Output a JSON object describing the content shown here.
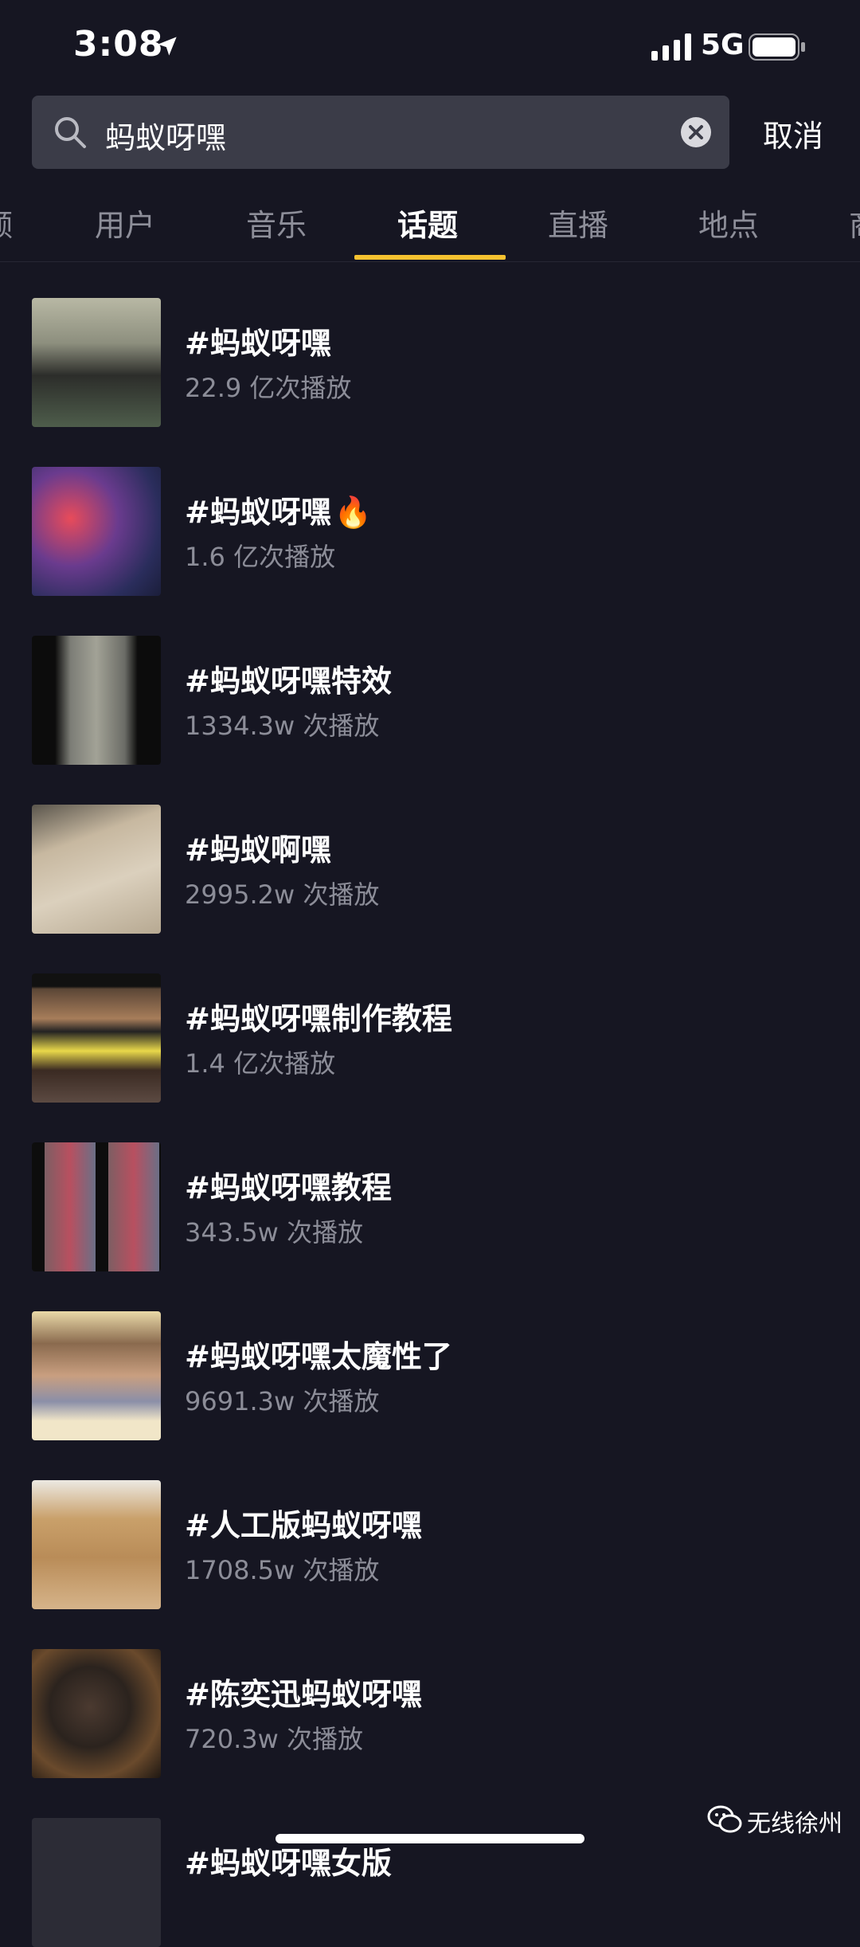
{
  "status_bar": {
    "time": "3:08",
    "network": "5G"
  },
  "search": {
    "query": "蚂蚁呀嘿",
    "cancel_label": "取消"
  },
  "tabs": [
    {
      "label": "频"
    },
    {
      "label": "用户"
    },
    {
      "label": "音乐"
    },
    {
      "label": "话题",
      "active": true
    },
    {
      "label": "直播"
    },
    {
      "label": "地点"
    },
    {
      "label": "商"
    }
  ],
  "results": [
    {
      "title": "#蚂蚁呀嘿",
      "plays": "22.9 亿次播放"
    },
    {
      "title": "#蚂蚁呀嘿",
      "badge": "🔥",
      "plays": "1.6 亿次播放"
    },
    {
      "title": "#蚂蚁呀嘿特效",
      "plays": "1334.3w 次播放"
    },
    {
      "title": "#蚂蚁啊嘿",
      "plays": "2995.2w 次播放"
    },
    {
      "title": "#蚂蚁呀嘿制作教程",
      "plays": "1.4 亿次播放"
    },
    {
      "title": "#蚂蚁呀嘿教程",
      "plays": "343.5w 次播放"
    },
    {
      "title": "#蚂蚁呀嘿太魔性了",
      "plays": "9691.3w 次播放"
    },
    {
      "title": "#人工版蚂蚁呀嘿",
      "plays": "1708.5w 次播放"
    },
    {
      "title": "#陈奕迅蚂蚁呀嘿",
      "plays": "720.3w 次播放"
    },
    {
      "title": "#蚂蚁呀嘿女版",
      "plays": ""
    }
  ],
  "watermark": {
    "text": "无线徐州"
  },
  "colors": {
    "background": "#161622",
    "accent": "#f6c230",
    "search_bg": "#3b3c48",
    "muted_text": "#8c8d98"
  }
}
